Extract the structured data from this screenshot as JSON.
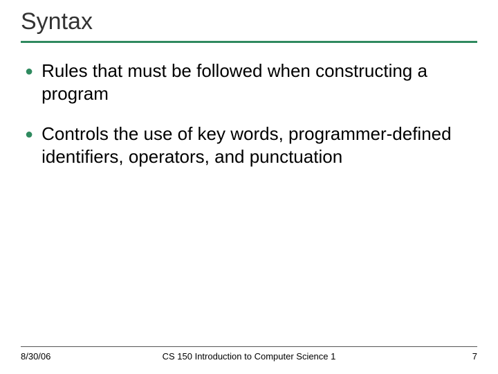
{
  "title": "Syntax",
  "bullets": [
    "Rules that must be followed when constructing a program",
    "Controls the use of key words, programmer-defined identifiers, operators, and punctuation"
  ],
  "footer": {
    "date": "8/30/06",
    "course": "CS 150 Introduction to Computer Science 1",
    "page": "7"
  },
  "colors": {
    "accent": "#2f8a5f"
  }
}
